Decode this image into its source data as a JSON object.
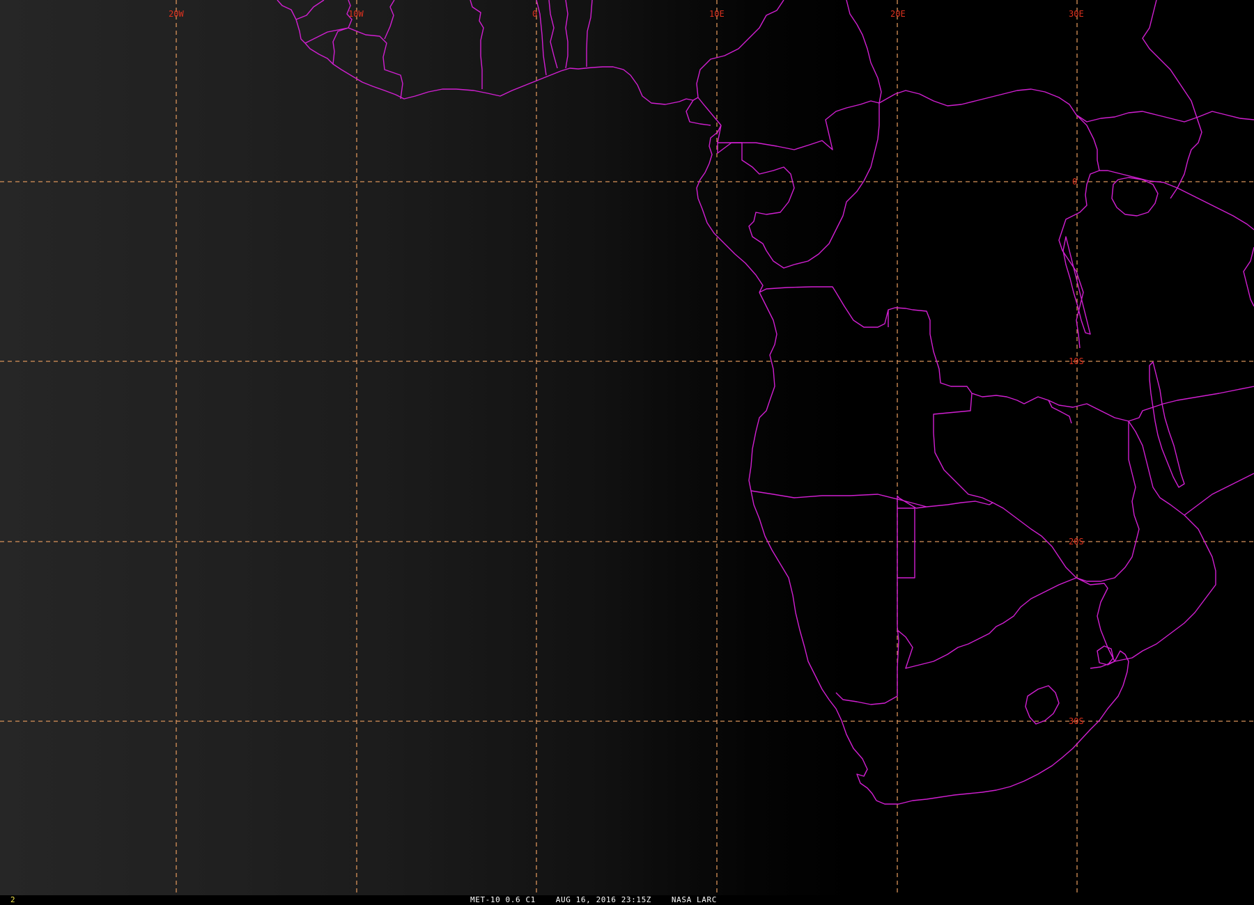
{
  "map": {
    "satellite_caption": "MET-10 0.6 C1",
    "datetime_caption": "AUG 16, 2016 23:15Z",
    "source_caption": "NASA LARC",
    "frame_number": "2",
    "colors": {
      "background": "#000000",
      "gridline": "#d9935a",
      "grid_label": "#e0321e",
      "border": "#d21fd2",
      "frame_number": "#f2e44a"
    },
    "longitude_labels": [
      "20W",
      "10W",
      "0",
      "10E",
      "20E",
      "30E"
    ],
    "latitude_labels": [
      "0",
      "10S",
      "20S",
      "30S"
    ]
  }
}
